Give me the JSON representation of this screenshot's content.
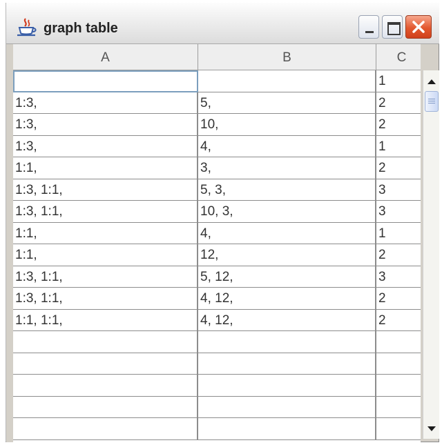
{
  "window": {
    "title": "graph table",
    "icon": "java-coffee-cup-icon",
    "controls": [
      "minimize",
      "maximize",
      "close"
    ],
    "colors": {
      "close_button": "#e3582f",
      "selected_cell_border": "#7b9ebd"
    }
  },
  "table": {
    "columns": [
      "A",
      "B",
      "C"
    ],
    "rows": [
      [
        "",
        "",
        "1"
      ],
      [
        "1:3,",
        "5,",
        "2"
      ],
      [
        "1:3,",
        "10,",
        "2"
      ],
      [
        "1:3,",
        "4,",
        "1"
      ],
      [
        "1:1,",
        "3,",
        "2"
      ],
      [
        "1:3, 1:1,",
        "5, 3,",
        "3"
      ],
      [
        "1:3, 1:1,",
        "10, 3,",
        "3"
      ],
      [
        "1:1,",
        "4,",
        "1"
      ],
      [
        "1:1,",
        "12,",
        "2"
      ],
      [
        "1:3, 1:1,",
        "5, 12,",
        "3"
      ],
      [
        "1:3, 1:1,",
        "4, 12,",
        "2"
      ],
      [
        "1:1, 1:1,",
        "4, 12,",
        "2"
      ],
      [
        "",
        "",
        ""
      ],
      [
        "",
        "",
        ""
      ],
      [
        "",
        "",
        ""
      ],
      [
        "",
        "",
        ""
      ],
      [
        "",
        "",
        ""
      ]
    ],
    "selected_cell": {
      "row": 0,
      "column": "A"
    }
  },
  "scrollbar": {
    "up_icon": "arrow-up-icon",
    "down_icon": "arrow-down-icon"
  }
}
